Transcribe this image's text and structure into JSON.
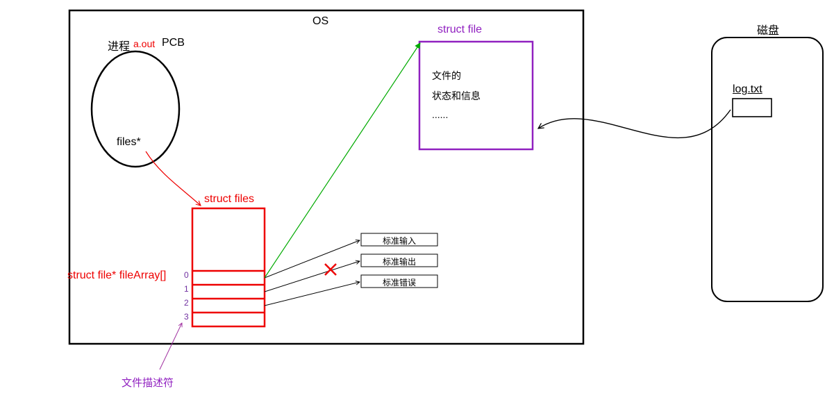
{
  "os": {
    "title": "OS",
    "process_label": "进程",
    "aout": "a.out",
    "pcb": "PCB",
    "files_ptr": "files*",
    "struct_files": "struct files",
    "file_array": "struct file* fileArray[]",
    "indices": {
      "i0": "0",
      "i1": "1",
      "i2": "2",
      "i3": "3"
    },
    "struct_file": "struct file",
    "file_info_l1": "文件的",
    "file_info_l2": "状态和信息",
    "file_info_l3": "......",
    "std": {
      "in": "标准输入",
      "out": "标准输出",
      "err": "标准错误"
    },
    "fd_label": "文件描述符"
  },
  "disk": {
    "title": "磁盘",
    "file": "log.txt"
  }
}
